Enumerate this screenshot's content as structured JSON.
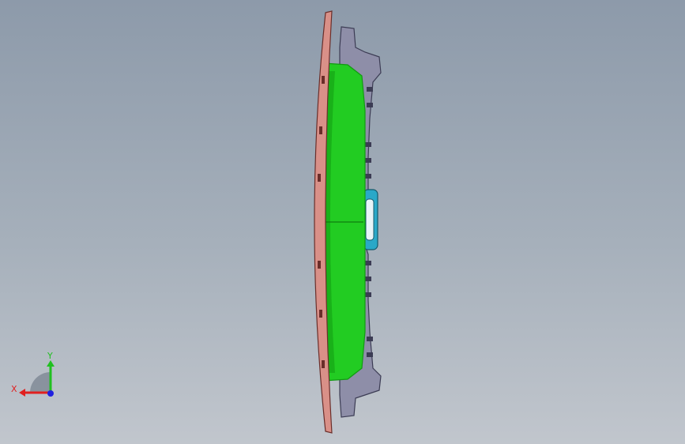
{
  "viewport": {
    "background_top": "#8d9aaa",
    "background_bottom": "#c1c6cd"
  },
  "model": {
    "colors": {
      "shell": "#22cc22",
      "shell_dark": "#129a12",
      "rim": "#d99088",
      "rim_edge": "#6a2e2a",
      "frame": "#8e8ea8",
      "frame_dark": "#3c3c54",
      "clip": "#2aa8c8"
    }
  },
  "triad": {
    "x_label": "X",
    "y_label": "Y",
    "x_color": "#e02020",
    "y_color": "#20c020",
    "z_color": "#2020e0"
  }
}
